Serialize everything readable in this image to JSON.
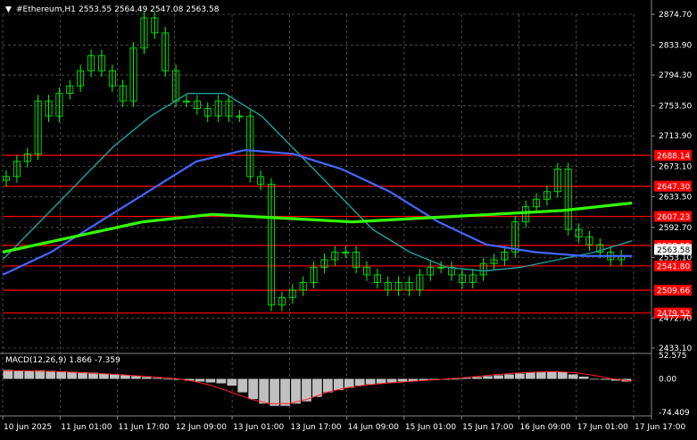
{
  "header": {
    "symbol": "#Ethereum,H1",
    "ohlc": "2553.55 2564.49 2547.08 2563.58"
  },
  "indicator_label": "MACD(12,26,9) 1.866 -7.359",
  "colors": {
    "background": "#000000",
    "grid": "#c8c8c8",
    "candle": "#00ff00",
    "level_line": "#ff0000",
    "level_label_bg": "#ff0000",
    "ma_fast": "#20a0a0",
    "ma_mid": "#4466ff",
    "ma_slow": "#33ff00",
    "macd_hist": "#c0c0c0",
    "macd_signal": "#ff2020",
    "axis_text": "#ffffff"
  },
  "chart_data": [
    {
      "type": "candlestick",
      "price_ticks": [
        "2874.70",
        "2833.90",
        "2794.30",
        "2753.50",
        "2713.90",
        "2673.10",
        "2633.50",
        "2592.70",
        "2553.10",
        "2472.70",
        "2433.10"
      ],
      "ylim": [
        2433.1,
        2874.7
      ],
      "x_ticks": [
        "10 Jun 2025",
        "11 Jun 01:00",
        "11 Jun 17:00",
        "12 Jun 09:00",
        "13 Jun 01:00",
        "13 Jun 17:00",
        "14 Jun 09:00",
        "15 Jun 01:00",
        "15 Jun 17:00",
        "16 Jun 09:00",
        "17 Jun 01:00",
        "17 Jun 17:00"
      ],
      "current_price": "2563.58",
      "levels": [
        "2688.14",
        "2647.30",
        "2607.23",
        "2568.90",
        "2541.80",
        "2509.66",
        "2479.52"
      ],
      "series": [
        {
          "role": "close",
          "values": [
            2660,
            2680,
            2690,
            2760,
            2740,
            2770,
            2780,
            2800,
            2820,
            2800,
            2780,
            2760,
            2830,
            2870,
            2850,
            2800,
            2760,
            2760,
            2750,
            2740,
            2760,
            2740,
            2740,
            2660,
            2650,
            2490,
            2500,
            2510,
            2520,
            2540,
            2550,
            2560,
            2560,
            2540,
            2530,
            2520,
            2510,
            2520,
            2510,
            2530,
            2540,
            2540,
            2530,
            2520,
            2530,
            2545,
            2550,
            2560,
            2600,
            2620,
            2630,
            2640,
            2670,
            2590,
            2580,
            2570,
            2560,
            2550,
            2555
          ]
        },
        {
          "role": "ma_fast",
          "values": [
            2550,
            2600,
            2650,
            2700,
            2740,
            2770,
            2770,
            2740,
            2690,
            2640,
            2590,
            2560,
            2540,
            2535,
            2540,
            2550,
            2560,
            2575
          ]
        },
        {
          "role": "ma_mid",
          "values": [
            2530,
            2560,
            2600,
            2640,
            2680,
            2695,
            2690,
            2670,
            2640,
            2600,
            2570,
            2560,
            2555,
            2555
          ]
        },
        {
          "role": "ma_slow",
          "values": [
            2560,
            2580,
            2600,
            2610,
            2605,
            2600,
            2605,
            2610,
            2615,
            2625
          ]
        }
      ]
    },
    {
      "type": "bar",
      "title": "MACD(12,26,9) 1.866 -7.359",
      "yticks": [
        "52.575",
        "0.00",
        "-74.409"
      ],
      "ylim": [
        -74.409,
        52.575
      ],
      "series": [
        {
          "role": "histogram",
          "values": [
            20,
            18,
            18,
            19,
            18,
            17,
            16,
            15,
            14,
            12,
            10,
            8,
            6,
            4,
            2,
            0,
            -2,
            -4,
            -6,
            -8,
            -10,
            -15,
            -30,
            -45,
            -55,
            -60,
            -60,
            -55,
            -50,
            -40,
            -30,
            -25,
            -20,
            -15,
            -12,
            -10,
            -8,
            -6,
            -5,
            -4,
            -3,
            -2,
            0,
            2,
            4,
            6,
            8,
            10,
            12,
            14,
            16,
            17,
            15,
            10,
            5,
            0,
            -2,
            -4,
            -6
          ]
        },
        {
          "role": "signal",
          "values": [
            18,
            18,
            17,
            16,
            14,
            12,
            10,
            7,
            4,
            1,
            -5,
            -15,
            -30,
            -45,
            -55,
            -55,
            -45,
            -30,
            -20,
            -14,
            -10,
            -7,
            -4,
            -1,
            2,
            6,
            10,
            13,
            15,
            16,
            14,
            8,
            0,
            -5
          ]
        }
      ]
    }
  ]
}
